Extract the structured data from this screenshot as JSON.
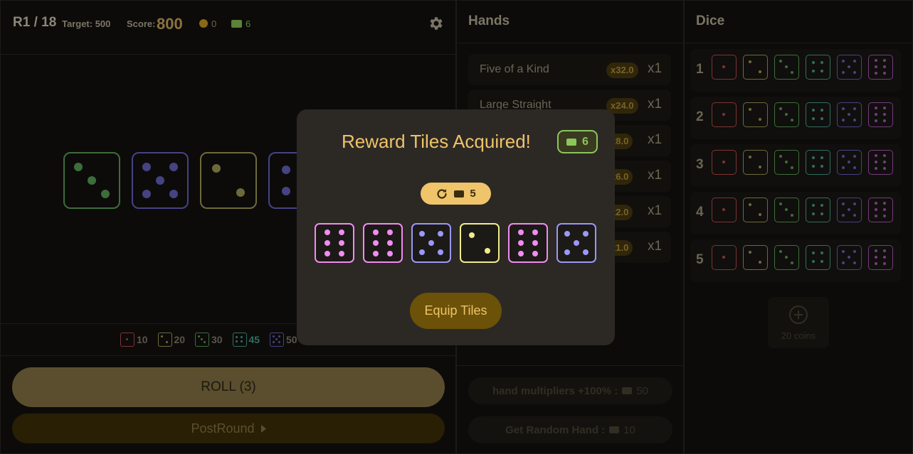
{
  "status": {
    "round": "R1 / 18",
    "target_label": "Target: 500",
    "score_label": "Score:",
    "score": "800",
    "coins": "0",
    "tickets": "6"
  },
  "board": {
    "dice": [
      {
        "face": 3,
        "color": "#5ea85a"
      },
      {
        "face": 5,
        "color": "#6a68c8"
      },
      {
        "face": 2,
        "color": "#a8a458"
      },
      {
        "face": 4,
        "color": "#6a68c8"
      }
    ]
  },
  "legend": [
    {
      "face": 1,
      "value": "10",
      "color": "#c0504e"
    },
    {
      "face": 2,
      "value": "20",
      "color": "#a8a458"
    },
    {
      "face": 3,
      "value": "30",
      "color": "#5ea85a"
    },
    {
      "face": 4,
      "value": "45",
      "color": "#4aa898"
    },
    {
      "face": 5,
      "value": "50",
      "color": "#6a68c8"
    }
  ],
  "actions": {
    "roll": "ROLL (3)",
    "post_round": "PostRound"
  },
  "hands": {
    "title": "Hands",
    "items": [
      {
        "name": "Five of a Kind",
        "mult": "x32.0",
        "level": "x1"
      },
      {
        "name": "Large Straight",
        "mult": "x24.0",
        "level": "x1"
      },
      {
        "name": "",
        "mult": "x8.0",
        "level": "x1"
      },
      {
        "name": "",
        "mult": "x6.0",
        "level": "x1"
      },
      {
        "name": "",
        "mult": "x2.0",
        "level": "x1"
      },
      {
        "name": "",
        "mult": "x1.0",
        "level": "x1"
      }
    ],
    "shop": [
      {
        "label": "hand multipliers +100% :",
        "cost": "50"
      },
      {
        "label": "Get Random Hand :",
        "cost": "10"
      }
    ]
  },
  "dice_panel": {
    "title": "Dice",
    "slots": [
      "1",
      "2",
      "3",
      "4",
      "5"
    ],
    "faces": [
      {
        "face": 1,
        "color": "#c0504e"
      },
      {
        "face": 2,
        "color": "#a8a458"
      },
      {
        "face": 3,
        "color": "#5ea85a"
      },
      {
        "face": 4,
        "color": "#4aa898"
      },
      {
        "face": 5,
        "color": "#6a68c8"
      },
      {
        "face": 6,
        "color": "#b45cc0"
      }
    ],
    "add_label": "20 coins"
  },
  "modal": {
    "title": "Reward Tiles Acquired!",
    "tickets": "6",
    "reroll_cost": "5",
    "tiles": [
      {
        "face": 6,
        "color": "#f08cf0"
      },
      {
        "face": 6,
        "color": "#f08cf0"
      },
      {
        "face": 5,
        "color": "#9a98f8"
      },
      {
        "face": 2,
        "color": "#f0ec8c"
      },
      {
        "face": 6,
        "color": "#f08cf0"
      },
      {
        "face": 5,
        "color": "#9a98f8"
      }
    ],
    "equip": "Equip Tiles"
  }
}
